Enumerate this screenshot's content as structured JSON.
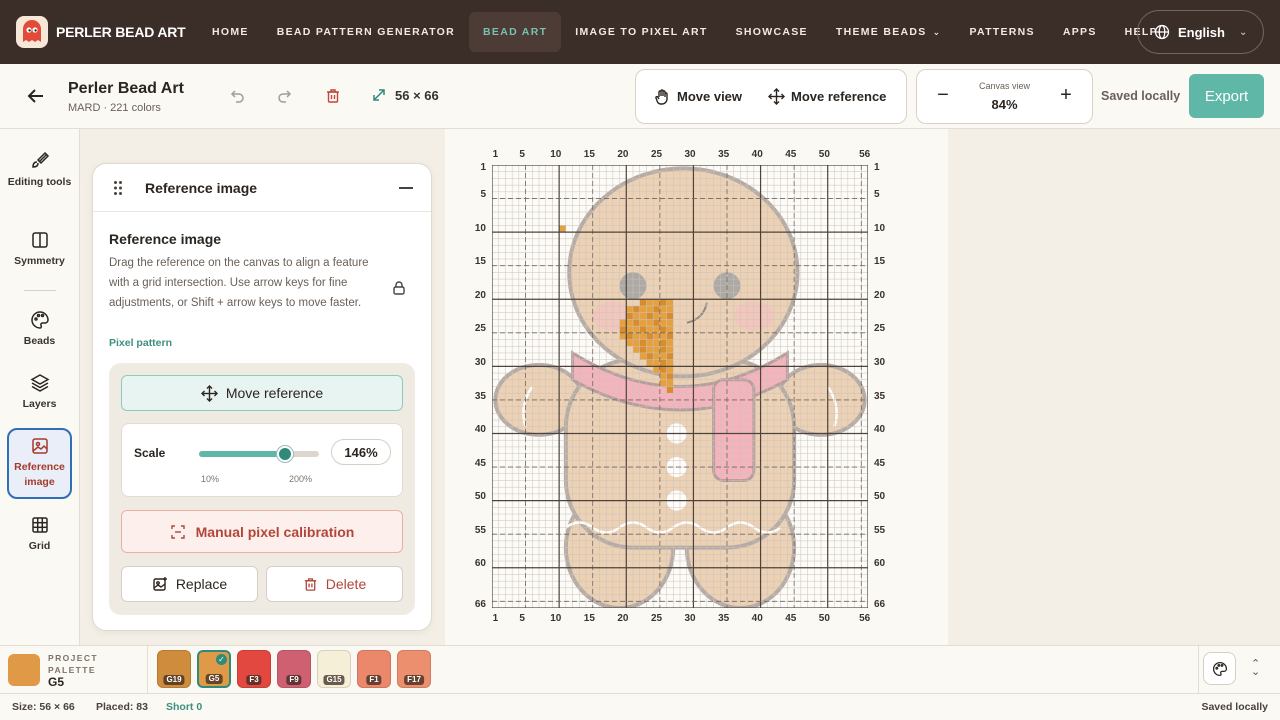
{
  "nav": {
    "brand": "PERLER BEAD ART",
    "items": [
      {
        "label": "HOME",
        "active": false
      },
      {
        "label": "BEAD PATTERN GENERATOR",
        "active": false
      },
      {
        "label": "BEAD ART",
        "active": true
      },
      {
        "label": "IMAGE TO PIXEL ART",
        "active": false
      },
      {
        "label": "SHOWCASE",
        "active": false
      },
      {
        "label": "THEME BEADS",
        "active": false,
        "dropdown": true
      },
      {
        "label": "PATTERNS",
        "active": false
      },
      {
        "label": "APPS",
        "active": false
      },
      {
        "label": "HELP",
        "active": false
      }
    ],
    "language": "English"
  },
  "header": {
    "title": "Perler Bead Art",
    "subtitle": "MARD · 221 colors",
    "size": "56 × 66",
    "move_view": "Move view",
    "move_reference": "Move reference",
    "zoom_label": "Canvas view",
    "zoom_value": "84%",
    "saved": "Saved locally",
    "export": "Export"
  },
  "tools": [
    {
      "label": "Editing tools",
      "icon": "brush-icon"
    },
    {
      "label": "Symmetry",
      "icon": "symmetry-icon"
    },
    {
      "label": "Beads",
      "icon": "palette-icon"
    },
    {
      "label": "Layers",
      "icon": "layers-icon"
    },
    {
      "label": "Reference image",
      "icon": "image-icon",
      "active": true
    },
    {
      "label": "Grid",
      "icon": "grid-icon"
    }
  ],
  "reference_panel": {
    "title": "Reference image",
    "heading": "Reference image",
    "description": "Drag the reference on the canvas to align a feature with a grid intersection. Use arrow keys for fine adjustments, or Shift + arrow keys to move faster.",
    "link": "Pixel pattern",
    "move_reference": "Move reference",
    "scale_label": "Scale",
    "scale_value": "146%",
    "scale_fraction": 0.72,
    "scale_min": "10%",
    "scale_max": "200%",
    "calibration": "Manual pixel calibration",
    "replace": "Replace",
    "delete": "Delete"
  },
  "chart_data": {
    "type": "bead-grid",
    "columns": 56,
    "rows": 66,
    "col_labels": [
      "1",
      "5",
      "10",
      "15",
      "20",
      "25",
      "30",
      "35",
      "40",
      "45",
      "50",
      "56"
    ],
    "row_labels": [
      "1",
      "5",
      "10",
      "15",
      "20",
      "25",
      "30",
      "35",
      "40",
      "45",
      "50",
      "55",
      "60",
      "66"
    ]
  },
  "palette": {
    "label": "PROJECT PALETTE",
    "current_code": "G5",
    "current_color": "#e09a47",
    "swatches": [
      {
        "code": "G19",
        "color": "#cf8c3c",
        "selected": false
      },
      {
        "code": "G5",
        "color": "#e09a47",
        "selected": true
      },
      {
        "code": "F3",
        "color": "#e2483f",
        "selected": false
      },
      {
        "code": "F9",
        "color": "#cf6072",
        "selected": false
      },
      {
        "code": "G15",
        "color": "#f5efd8",
        "selected": false
      },
      {
        "code": "F1",
        "color": "#eb876b",
        "selected": false
      },
      {
        "code": "F17",
        "color": "#ec8f6e",
        "selected": false
      }
    ]
  },
  "status": {
    "size": "Size: 56 × 66",
    "placed": "Placed: 83",
    "short": "Short 0",
    "saved": "Saved locally"
  }
}
